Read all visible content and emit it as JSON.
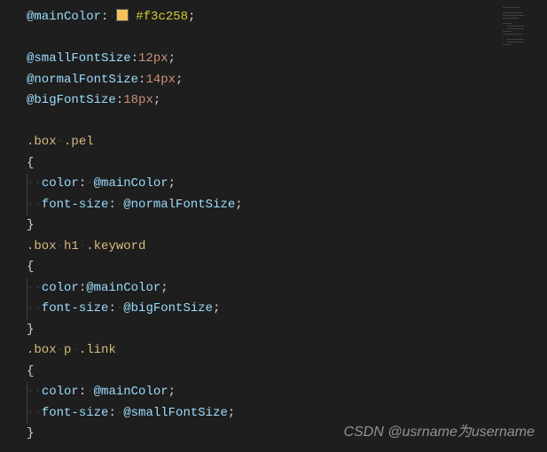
{
  "colors": {
    "mainColorHex": "#f3c258"
  },
  "code": {
    "vars": {
      "mainColor": "@mainColor",
      "smallFont": "@smallFontSize",
      "normalFont": "@normalFontSize",
      "bigFont": "@bigFontSize"
    },
    "vals": {
      "smallFont": "12px",
      "normalFont": "14px",
      "bigFont": "18px"
    },
    "sel": {
      "pel": ".box .pel",
      "keyword": ".box h1 .keyword",
      "link": ".box p .link"
    },
    "prop": {
      "color": "color",
      "fontSize": "font-size"
    },
    "puncColon": ":",
    "puncSemi": ";",
    "braceOpen": "{",
    "braceClose": "}",
    "ws_dot": "·",
    "ws_ddot": "··"
  },
  "watermark": "CSDN @usrname为username"
}
